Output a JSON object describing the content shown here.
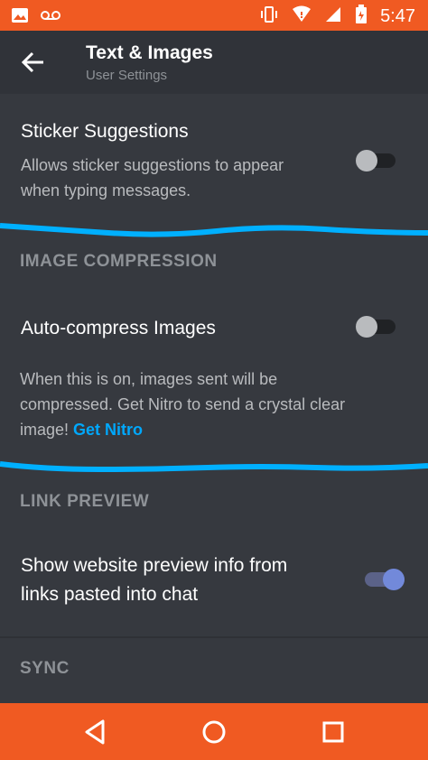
{
  "status_bar": {
    "time": "5:47"
  },
  "header": {
    "title": "Text & Images",
    "subtitle": "User Settings"
  },
  "sticker": {
    "title": "Sticker Suggestions",
    "desc_line1": "Allows sticker suggestions to appear",
    "desc_line2": "when typing messages.",
    "enabled": false
  },
  "image_compression": {
    "section_label": "IMAGE COMPRESSION",
    "title": "Auto-compress Images",
    "desc_line1": "When this is on, images sent will be",
    "desc_line2": "compressed. Get Nitro to send a crystal clear",
    "desc_line3": "image!",
    "link": "Get Nitro",
    "enabled": false
  },
  "link_preview": {
    "section_label": "LINK PREVIEW",
    "title_line1": "Show website preview info from",
    "title_line2": "links pasted into chat",
    "enabled": true
  },
  "sync": {
    "section_label": "SYNC"
  },
  "colors": {
    "accent": "#7289da",
    "statusbar": "#f05a22",
    "link": "#00a8fc",
    "annotation": "#00b0ff"
  }
}
